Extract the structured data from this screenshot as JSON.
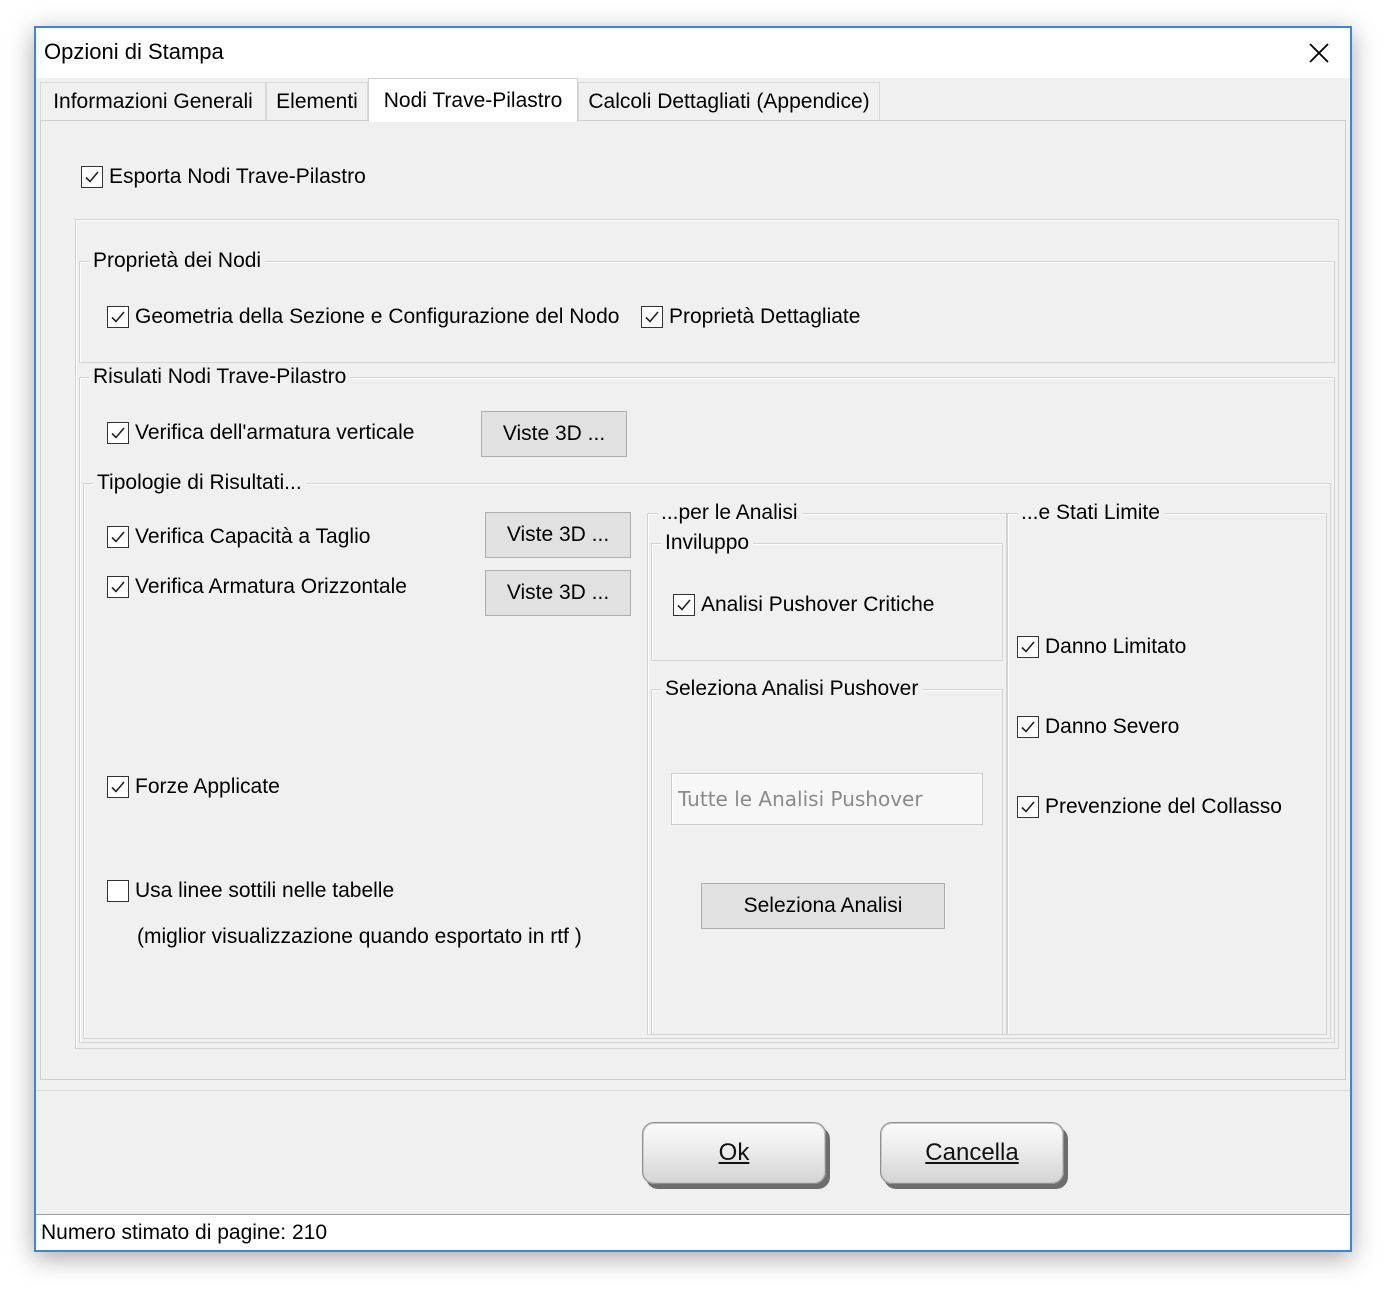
{
  "window": {
    "title": "Opzioni di Stampa"
  },
  "tabs": [
    {
      "label": "Informazioni Generali"
    },
    {
      "label": "Elementi"
    },
    {
      "label": "Nodi Trave-Pilastro"
    },
    {
      "label": "Calcoli Dettagliati (Appendice)"
    }
  ],
  "active_tab": "Nodi Trave-Pilastro",
  "export": {
    "label": "Esporta Nodi Trave-Pilastro",
    "checked": true
  },
  "node_properties": {
    "legend": "Proprietà dei Nodi",
    "geometry_label": "Geometria della Sezione e Configurazione del Nodo",
    "geometry_checked": true,
    "detailed_label": "Proprietà Dettagliate",
    "detailed_checked": true
  },
  "results": {
    "legend": "Risulati Nodi Trave-Pilastro",
    "vertical_label": "Verifica dell'armatura verticale",
    "vertical_checked": true,
    "views_3d_label": "Viste 3D ...",
    "types": {
      "legend": "Tipologie di Risultati...",
      "shear_label": "Verifica Capacità a Taglio",
      "shear_checked": true,
      "horizontal_label": "Verifica Armatura Orizzontale",
      "horizontal_checked": true,
      "forces_label": "Forze Applicate",
      "forces_checked": true,
      "thin_lines_label": "Usa linee sottili nelle tabelle",
      "thin_lines_checked": false,
      "thin_lines_note": "(miglior visualizzazione quando esportato in rtf )"
    }
  },
  "analysis": {
    "legend": "...per le Analisi",
    "envelope_legend": "Inviluppo",
    "critical_label": "Analisi Pushover Critiche",
    "critical_checked": true,
    "select_legend": "Seleziona Analisi Pushover",
    "select_value": "Tutte le Analisi Pushover",
    "select_button": "Seleziona Analisi"
  },
  "limit_states": {
    "legend": "...e Stati Limite",
    "items": [
      {
        "label": "Danno Limitato",
        "checked": true
      },
      {
        "label": "Danno Severo",
        "checked": true
      },
      {
        "label": "Prevenzione del Collasso",
        "checked": true
      }
    ]
  },
  "buttons": {
    "ok_label": "Ok",
    "cancel_label": "Cancella"
  },
  "status": {
    "text": "Numero stimato di pagine: 210"
  }
}
